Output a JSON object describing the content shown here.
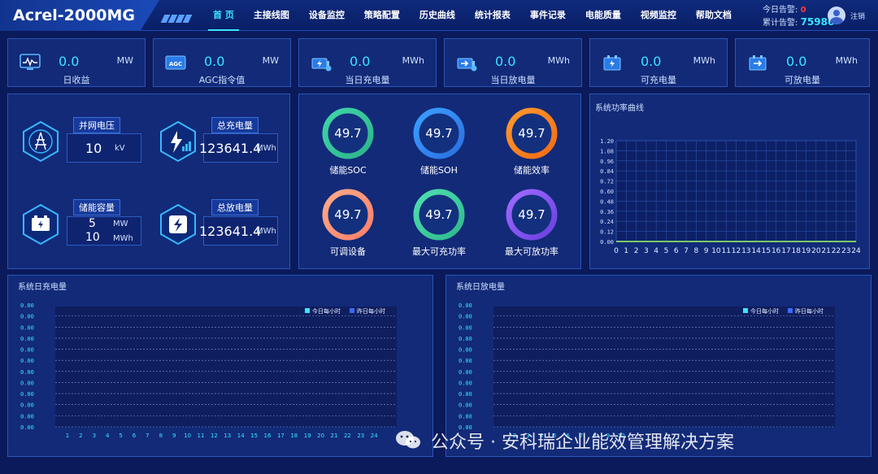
{
  "app": {
    "title": "Acrel-2000MG"
  },
  "nav": [
    "首 页",
    "主接线图",
    "设备监控",
    "策略配置",
    "历史曲线",
    "统计报表",
    "事件记录",
    "电能质量",
    "视频监控",
    "帮助文档"
  ],
  "alarm": {
    "today_label": "今日告警:",
    "today_value": "0",
    "total_label": "累计告警:",
    "total_value": "75986"
  },
  "user": {
    "logout": "注销"
  },
  "kpis": [
    {
      "label": "日收益",
      "value": "0.0",
      "unit": "MW",
      "icon": "monitor-chart-icon"
    },
    {
      "label": "AGC指令值",
      "value": "0.0",
      "unit": "MW",
      "icon": "agc-icon",
      "badge": "AGC"
    },
    {
      "label": "当日充电量",
      "value": "0.0",
      "unit": "MWh",
      "icon": "battery-charge-icon"
    },
    {
      "label": "当日放电量",
      "value": "0.0",
      "unit": "MWh",
      "icon": "battery-discharge-icon"
    },
    {
      "label": "可充电量",
      "value": "0.0",
      "unit": "MWh",
      "icon": "chargeable-icon"
    },
    {
      "label": "可放电量",
      "value": "0.0",
      "unit": "MWh",
      "icon": "dischargeable-icon"
    }
  ],
  "grid": {
    "voltage_label": "并网电压",
    "voltage_value": "10",
    "voltage_unit": "kV",
    "capacity_label": "储能容量",
    "capacity_power": "5",
    "capacity_power_unit": "MW",
    "capacity_energy": "10",
    "capacity_energy_unit": "MWh",
    "charge_label": "总充电量",
    "charge_value": "123641.4",
    "charge_unit": "MWh",
    "discharge_label": "总放电量",
    "discharge_value": "123641.4",
    "discharge_unit": "MWh"
  },
  "rings": [
    {
      "label": "储能SOC",
      "value": "49.7",
      "color": "#3fd6a8",
      "color2": "#2db38a"
    },
    {
      "label": "储能SOH",
      "value": "49.7",
      "color": "#3aa0ff",
      "color2": "#2b6fe0"
    },
    {
      "label": "储能效率",
      "value": "49.7",
      "color": "#ff9a2e",
      "color2": "#f36b14"
    },
    {
      "label": "可调设备",
      "value": "49.7",
      "color": "#ffab8a",
      "color2": "#ff7f6a"
    },
    {
      "label": "最大可充功率",
      "value": "49.7",
      "color": "#4fe0b0",
      "color2": "#2fb88c"
    },
    {
      "label": "最大可放功率",
      "value": "49.7",
      "color": "#a06bff",
      "color2": "#6a3fe0"
    }
  ],
  "power_curve": {
    "title": "系统功率曲线",
    "yticks": [
      "1.20",
      "1.08",
      "0.96",
      "0.84",
      "0.72",
      "0.60",
      "0.48",
      "0.36",
      "0.24",
      "0.12",
      "0.00"
    ],
    "xticks": [
      "0",
      "1",
      "2",
      "3",
      "4",
      "5",
      "6",
      "7",
      "8",
      "9",
      "10",
      "11",
      "12",
      "13",
      "14",
      "15",
      "16",
      "17",
      "18",
      "19",
      "20",
      "21",
      "22",
      "23",
      "24"
    ]
  },
  "daily_charge": {
    "title": "系统日充电量",
    "legend": [
      "今日每小时",
      "昨日每小时"
    ],
    "yticks": [
      "0.00",
      "0.00",
      "0.00",
      "0.00",
      "0.00",
      "0.00",
      "0.00",
      "0.00",
      "0.00",
      "0.00",
      "0.00",
      "0.00"
    ],
    "xticks": [
      "1",
      "2",
      "3",
      "4",
      "5",
      "6",
      "7",
      "8",
      "9",
      "10",
      "11",
      "12",
      "13",
      "14",
      "15",
      "16",
      "17",
      "18",
      "19",
      "20",
      "21",
      "22",
      "23",
      "24"
    ]
  },
  "daily_discharge": {
    "title": "系统日放电量",
    "legend": [
      "今日每小时",
      "昨日每小时"
    ],
    "yticks": [
      "0.00",
      "0.00",
      "0.00",
      "0.00",
      "0.00",
      "0.00",
      "0.00",
      "0.00",
      "0.00",
      "0.00",
      "0.00",
      "0.00"
    ],
    "xticks": [
      "2",
      "3",
      "4",
      "5",
      "6",
      "7",
      "8",
      "9",
      "10"
    ]
  },
  "watermark": "公众号 · 安科瑞企业能效管理解决方案"
}
